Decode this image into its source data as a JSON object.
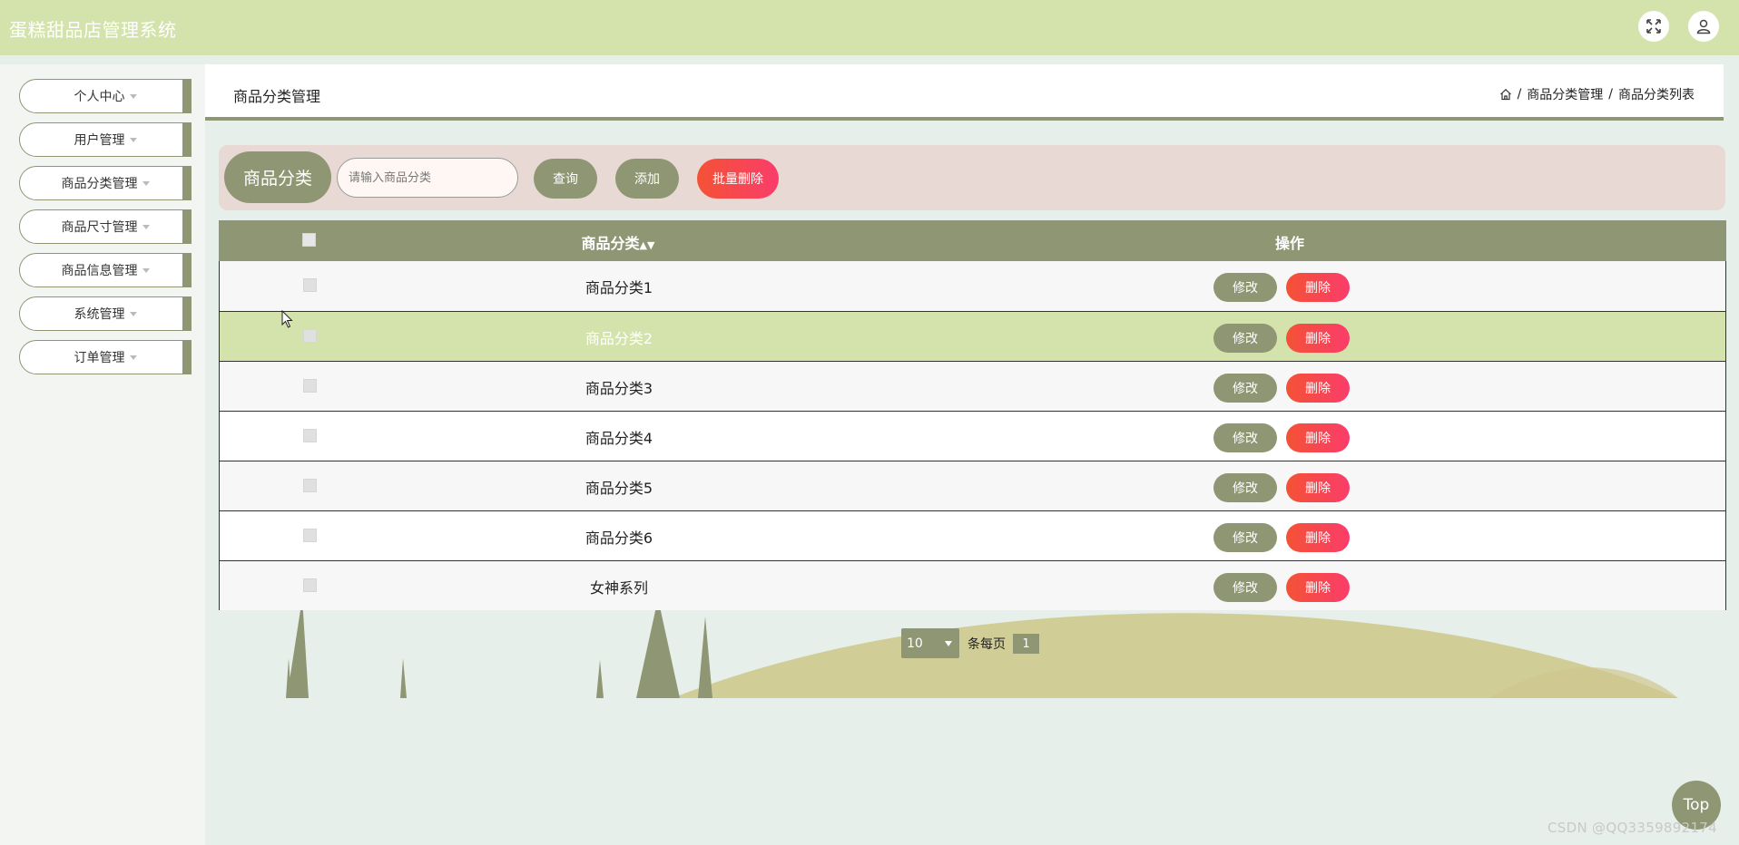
{
  "app": {
    "title": "蛋糕甜品店管理系统"
  },
  "header": {
    "fullscreen_icon": "expand-icon",
    "user_icon": "user-icon"
  },
  "sidebar": {
    "items": [
      {
        "label": "个人中心"
      },
      {
        "label": "用户管理"
      },
      {
        "label": "商品分类管理"
      },
      {
        "label": "商品尺寸管理"
      },
      {
        "label": "商品信息管理"
      },
      {
        "label": "系统管理"
      },
      {
        "label": "订单管理"
      }
    ]
  },
  "page": {
    "title": "商品分类管理",
    "breadcrumb": {
      "home_icon": "home-icon",
      "sep": "/",
      "level1": "商品分类管理",
      "level2": "商品分类列表"
    }
  },
  "search": {
    "label": "商品分类",
    "placeholder": "请输入商品分类",
    "query_button": "查询",
    "add_button": "添加",
    "batch_delete_button": "批量删除"
  },
  "table": {
    "columns": {
      "name": "商品分类",
      "actions": "操作"
    },
    "edit_label": "修改",
    "delete_label": "删除",
    "rows": [
      {
        "name": "商品分类1"
      },
      {
        "name": "商品分类2"
      },
      {
        "name": "商品分类3"
      },
      {
        "name": "商品分类4"
      },
      {
        "name": "商品分类5"
      },
      {
        "name": "商品分类6"
      },
      {
        "name": "女神系列"
      }
    ]
  },
  "pagination": {
    "page_size": "10",
    "per_page_label": "条每页",
    "current_page": "1"
  },
  "top_button": "Top",
  "watermark": "CSDN @QQ3359892174",
  "colors": {
    "header": "#d4e3ab",
    "accent": "#8e9673",
    "danger": "#f44a4a",
    "search_bg": "#e9d9d4"
  }
}
